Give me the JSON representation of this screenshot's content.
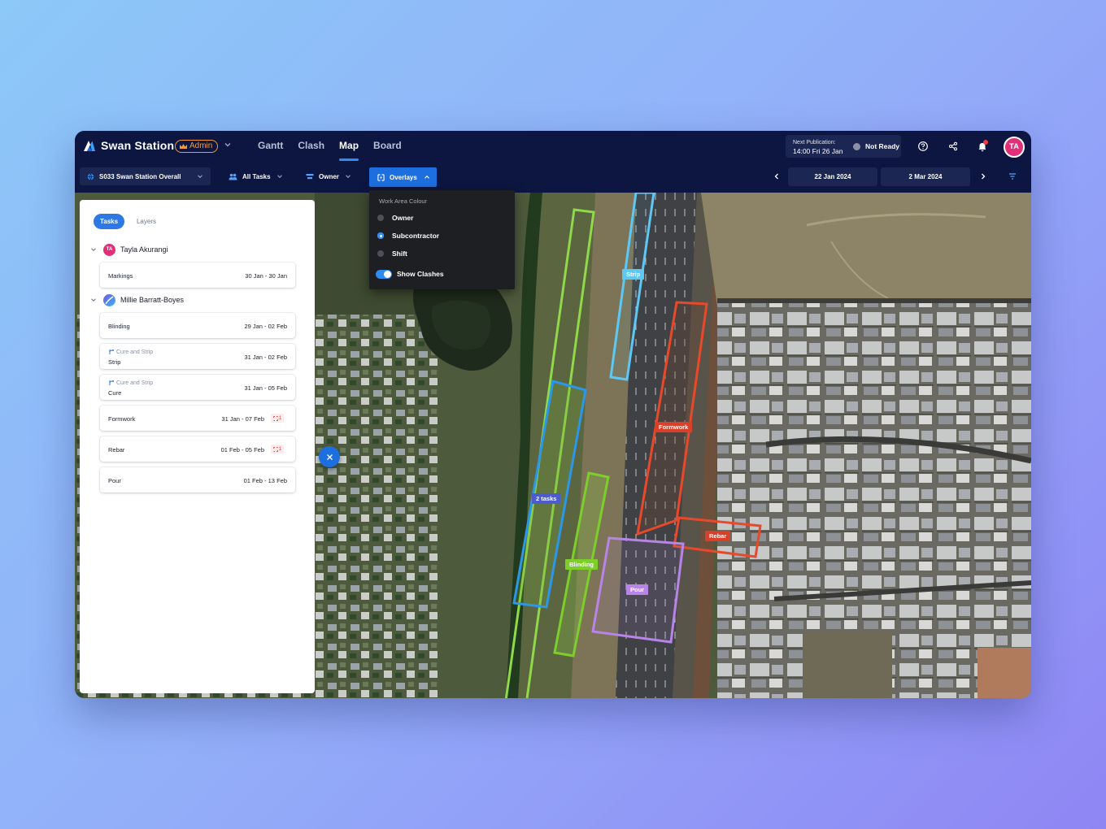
{
  "app": {
    "title": "Swan Station",
    "role_badge": "Admin"
  },
  "nav": {
    "tabs": [
      {
        "label": "Gantt",
        "active": false
      },
      {
        "label": "Clash",
        "active": false
      },
      {
        "label": "Map",
        "active": true
      },
      {
        "label": "Board",
        "active": false
      }
    ]
  },
  "publication": {
    "label": "Next Publication:",
    "value": "14:00 Fri 26 Jan",
    "status": "Not Ready"
  },
  "user": {
    "initials": "TA"
  },
  "toolbar": {
    "project": "S033 Swan Station Overall",
    "tasks_filter": "All Tasks",
    "group_filter": "Owner",
    "overlays": "Overlays",
    "date_start": "22 Jan 2024",
    "date_end": "2 Mar 2024"
  },
  "overlay_menu": {
    "heading": "Work Area Colour",
    "options": [
      {
        "label": "Owner",
        "selected": false
      },
      {
        "label": "Subcontractor",
        "selected": true
      },
      {
        "label": "Shift",
        "selected": false
      }
    ],
    "toggle_label": "Show Clashes",
    "toggle_on": true
  },
  "panel": {
    "tabs": [
      {
        "label": "Tasks",
        "active": true
      },
      {
        "label": "Layers",
        "active": false
      }
    ],
    "people": [
      {
        "name": "Tayla Akurangi",
        "initials": "TA",
        "tasks": [
          {
            "name": "Markings",
            "dates": "30 Jan - 30 Jan"
          }
        ]
      },
      {
        "name": "Millie Barratt-Boyes",
        "initials": "",
        "tasks": [
          {
            "name": "Blinding",
            "dates": "29 Jan - 02 Feb"
          },
          {
            "name": "Strip",
            "parent": "Cure and Strip",
            "dates": "31 Jan - 02 Feb"
          },
          {
            "name": "Cure",
            "parent": "Cure and Strip",
            "dates": "31 Jan - 05 Feb"
          },
          {
            "name": "Formwork",
            "dates": "31 Jan - 07 Feb",
            "clashes": "1"
          },
          {
            "name": "Rebar",
            "dates": "01 Feb - 05 Feb",
            "clashes": "1"
          },
          {
            "name": "Pour",
            "dates": "01 Feb - 13 Feb"
          }
        ]
      }
    ]
  },
  "map_labels": {
    "strip": "Strip",
    "formwork": "Formwork",
    "two_tasks": "2 tasks",
    "rebar": "Rebar",
    "blinding": "Blinding",
    "pour": "Pour"
  },
  "colors": {
    "accent": "#1d6fe0",
    "nav_bg": "#0c1640",
    "strip": "#5ec8f5",
    "formwork": "#e8492b",
    "cure_group": "#2b97e6",
    "blinding": "#7ccf2a",
    "pour": "#b884e8",
    "avatar": "#e0307a"
  }
}
